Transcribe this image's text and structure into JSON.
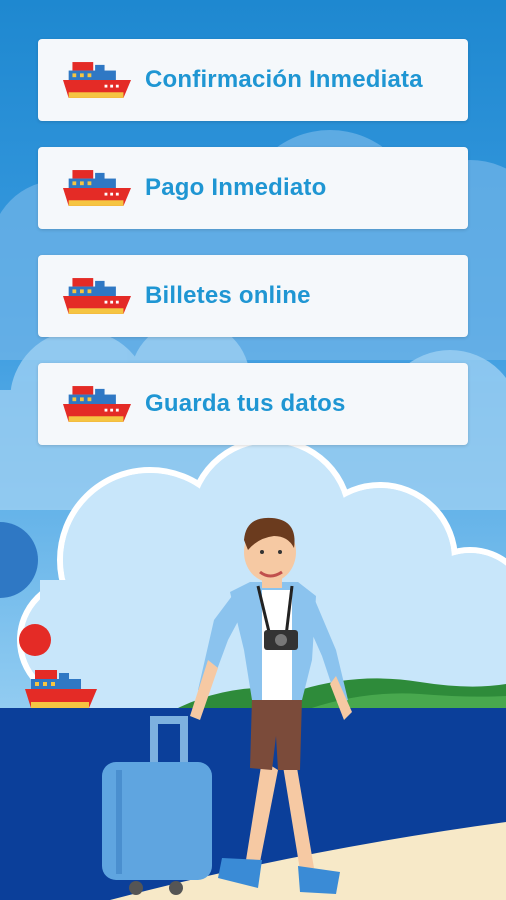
{
  "features": [
    {
      "label": "Confirmación Inmediata",
      "icon": "ferry-icon"
    },
    {
      "label": "Pago Inmediato",
      "icon": "ferry-icon"
    },
    {
      "label": "Billetes online",
      "icon": "ferry-icon"
    },
    {
      "label": "Guarda tus datos",
      "icon": "ferry-icon"
    }
  ],
  "colors": {
    "sky": "#2b8fd4",
    "card": "#f5f8fb",
    "accent_text": "#1f96d3",
    "sea": "#0b3f9a",
    "sand": "#f7e9c8"
  },
  "illustration": {
    "description_icons": [
      "cloud-icon",
      "ferry-icon",
      "sun-icon",
      "traveler-figure",
      "suitcase-icon",
      "camera-icon"
    ]
  }
}
